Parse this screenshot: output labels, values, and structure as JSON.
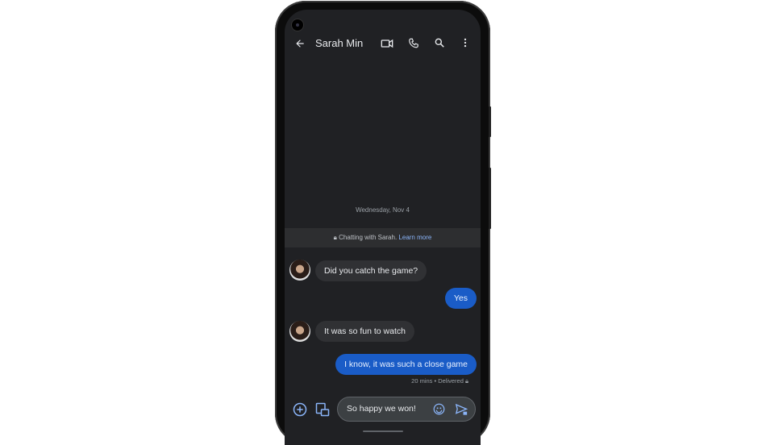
{
  "header": {
    "contact_name": "Sarah Min",
    "icons": [
      "back-arrow",
      "video-call",
      "phone",
      "search",
      "more-vert"
    ]
  },
  "conversation": {
    "date": "Wednesday, Nov 4",
    "banner": {
      "text": "Chatting with Sarah.",
      "link": "Learn more"
    },
    "messages": [
      {
        "from": "received",
        "text": "Did you catch the game?"
      },
      {
        "from": "sent",
        "text": "Yes"
      },
      {
        "from": "received",
        "text": "It was so fun to watch"
      },
      {
        "from": "sent",
        "text": "I know, it was such a close game"
      }
    ],
    "status": "20 mins • Delivered"
  },
  "composer": {
    "value": "So happy we won!"
  },
  "colors": {
    "background": "#202124",
    "sent_bubble": "#1a5cc7",
    "received_bubble": "#303134",
    "accent": "#8ab4f8"
  }
}
